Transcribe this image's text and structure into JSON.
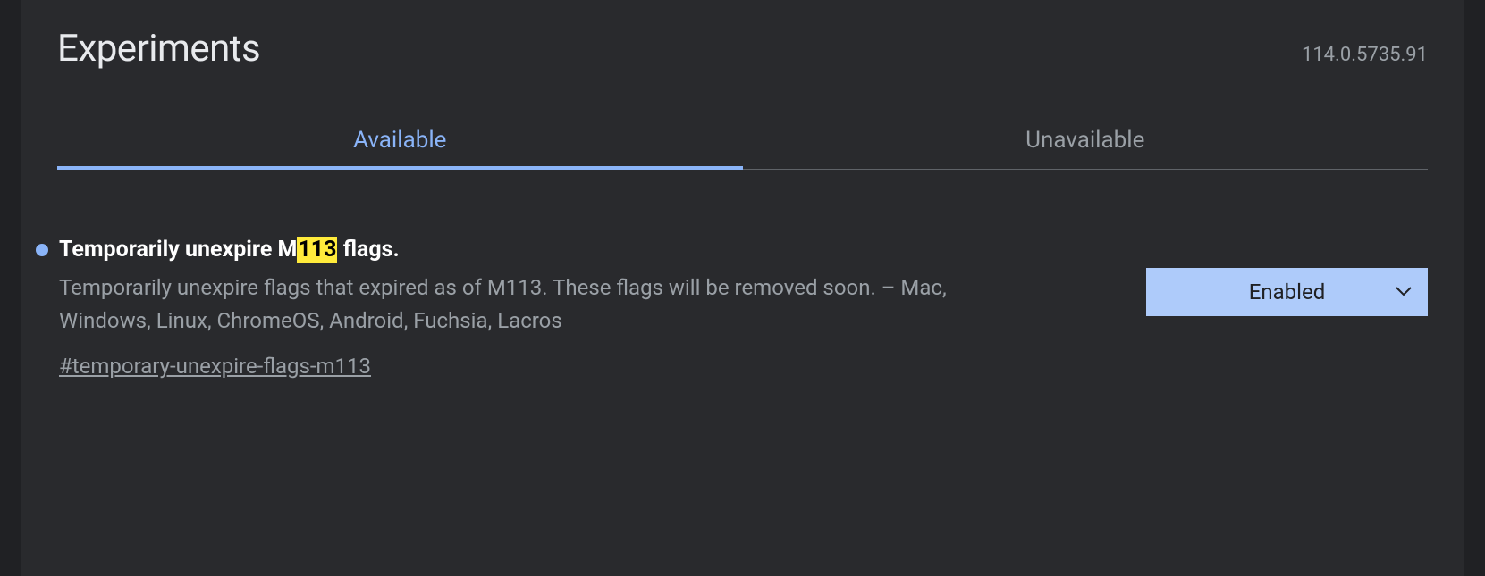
{
  "header": {
    "title": "Experiments",
    "version": "114.0.5735.91"
  },
  "tabs": {
    "available": "Available",
    "unavailable": "Unavailable"
  },
  "flag": {
    "title_prefix": "Temporarily unexpire M",
    "title_highlight": "113",
    "title_suffix": " flags.",
    "description": "Temporarily unexpire flags that expired as of M113. These flags will be removed soon. – Mac, Windows, Linux, ChromeOS, Android, Fuchsia, Lacros",
    "anchor": "#temporary-unexpire-flags-m113",
    "select_value": "Enabled"
  }
}
